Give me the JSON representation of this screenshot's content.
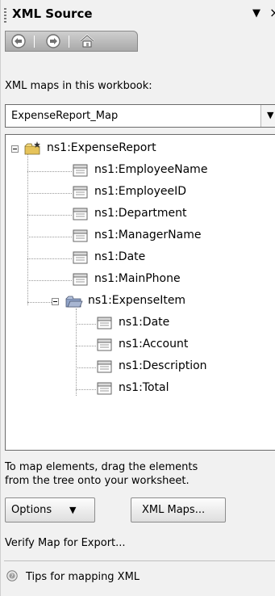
{
  "pane": {
    "title": "XML Source",
    "menu_arrow": "▼",
    "close_glyph": "×"
  },
  "toolbar": {
    "back_icon": "back-arrow-icon",
    "forward_icon": "forward-arrow-icon",
    "home_icon": "home-icon"
  },
  "maps": {
    "label": "XML maps in this workbook:",
    "selected": "ExpenseReport_Map",
    "dropdown_glyph": "▼"
  },
  "tree": {
    "root": "ns1:ExpenseReport",
    "root_children": [
      "ns1:EmployeeName",
      "ns1:EmployeeID",
      "ns1:Department",
      "ns1:ManagerName",
      "ns1:Date",
      "ns1:MainPhone"
    ],
    "group": "ns1:ExpenseItem",
    "group_children": [
      "ns1:Date",
      "ns1:Account",
      "ns1:Description",
      "ns1:Total"
    ]
  },
  "footer": {
    "hint_line1": "To map elements, drag the elements",
    "hint_line2": "from the tree onto your worksheet.",
    "options_label": "Options",
    "options_arrow": "▼",
    "xml_maps_label": "XML Maps...",
    "verify_link": "Verify Map for Export...",
    "tips_link": "Tips for mapping XML"
  },
  "colors": {
    "pane_background": "#f1f1f1",
    "toolbar_gradient_top": "#cfcfcf",
    "toolbar_gradient_bottom": "#a9a9a9",
    "folder_yellow": "#e6c35a",
    "folder_blue": "#8fa2c7"
  }
}
